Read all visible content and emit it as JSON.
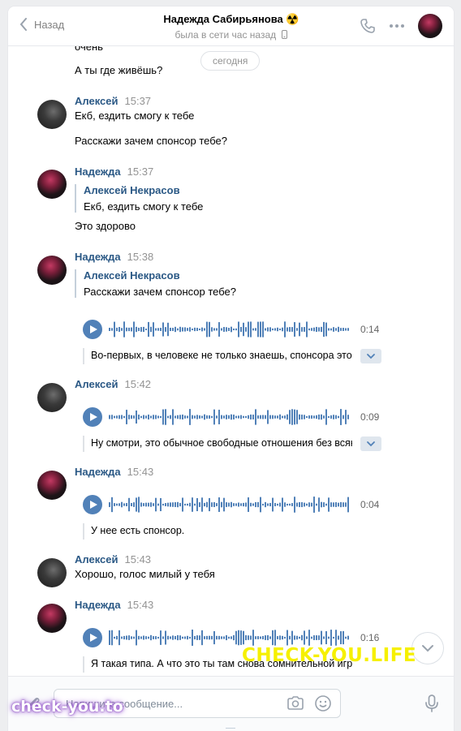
{
  "header": {
    "back_label": "Назад",
    "title": "Надежда Сабирьянова ☢️",
    "status": "была в сети час назад"
  },
  "feed": {
    "date_label": "сегодня",
    "messages": [
      {
        "id": "m0a",
        "text": "очень"
      },
      {
        "id": "m0b",
        "text": "А ты где живёшь?"
      },
      {
        "id": "m1",
        "author": "Алексей",
        "time": "15:37",
        "lines": [
          "Екб, ездить смогу к тебе",
          "Расскажи зачем спонсор тебе?"
        ]
      },
      {
        "id": "m2",
        "author": "Надежда",
        "time": "15:37",
        "reply": {
          "author": "Алексей Некрасов",
          "text": "Екб, ездить смогу к тебе"
        },
        "lines": [
          "Это здорово"
        ]
      },
      {
        "id": "m3",
        "author": "Надежда",
        "time": "15:38",
        "reply": {
          "author": "Алексей Некрасов",
          "text": "Расскажи зачем спонсор тебе?"
        },
        "audio": {
          "duration": "0:14",
          "transcript": "Во-первых, в человеке не только знаешь, спонсора это не только дает"
        }
      },
      {
        "id": "m4",
        "author": "Алексей",
        "time": "15:42",
        "audio": {
          "duration": "0:09",
          "transcript": "Ну смотри, это обычное свободные отношения без всяких обязательств"
        }
      },
      {
        "id": "m5",
        "author": "Надежда",
        "time": "15:43",
        "audio": {
          "duration": "0:04",
          "transcript": "У нее есть спонсор."
        }
      },
      {
        "id": "m6",
        "author": "Алексей",
        "time": "15:43",
        "lines": [
          "Хорошо, голос милый у тебя"
        ]
      },
      {
        "id": "m7",
        "author": "Надежда",
        "time": "15:43",
        "audio": {
          "duration": "0:16",
          "transcript": "Я такая типа. А что это ты там снова сомнительной игрой"
        }
      }
    ]
  },
  "compose": {
    "placeholder": "Напишите сообщение..."
  },
  "watermarks": {
    "center": "CHECK-YOU.LIFE",
    "corner": "check-you.to"
  },
  "colors": {
    "accent": "#5181b8",
    "link": "#2a5885",
    "watermark_yellow": "#f6f000"
  }
}
